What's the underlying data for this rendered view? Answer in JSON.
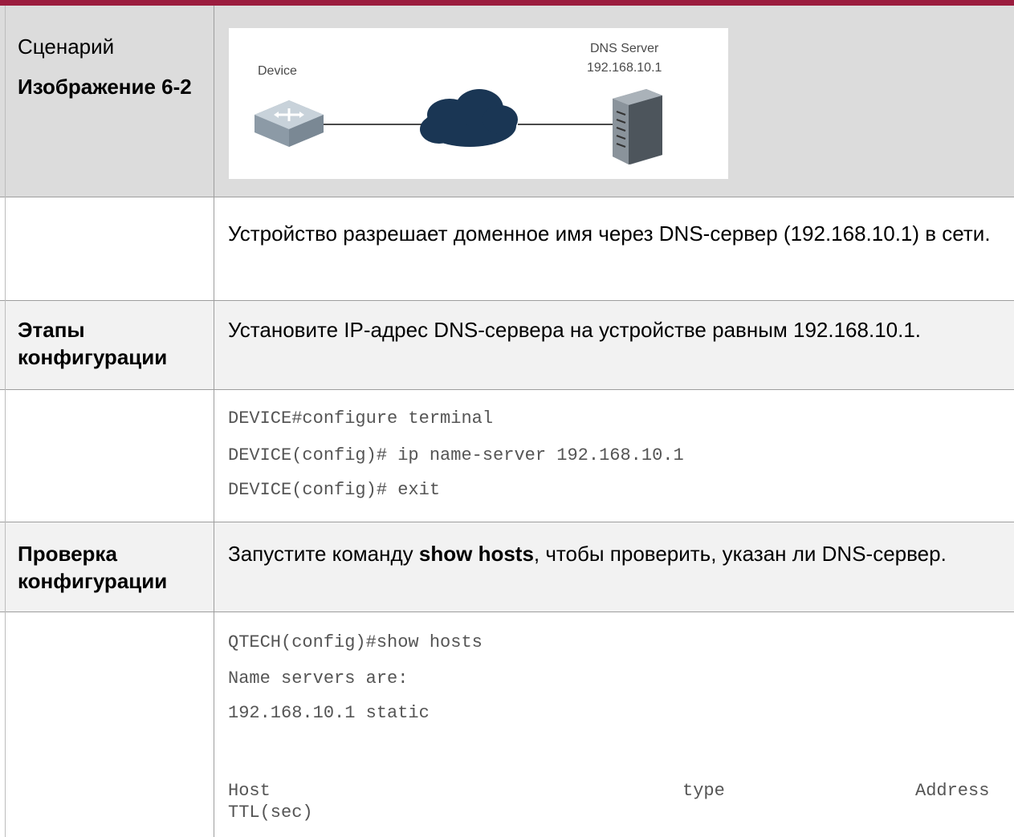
{
  "scenario": {
    "label": "Сценарий",
    "figure_label": "Изображение 6-2",
    "diagram": {
      "device_label": "Device",
      "server_label": "DNS Server",
      "server_ip": "192.168.10.1"
    }
  },
  "description": "Устройство разрешает доменное имя через DNS-сервер (192.168.10.1) в сети.",
  "config_steps": {
    "label_line1": "Этапы",
    "label_line2": "конфигурации",
    "text": "Установите IP-адрес DNS-сервера на устройстве равным 192.168.10.1."
  },
  "config_code": [
    "DEVICE#configure terminal",
    "DEVICE(config)# ip name-server 192.168.10.1",
    "DEVICE(config)# exit"
  ],
  "verification": {
    "label_line1": "Проверка",
    "label_line2": "конфигурации",
    "text_before": "Запустите команду ",
    "command": "show hosts",
    "text_after": ", чтобы проверить, указан ли DNS-сервер."
  },
  "verify_output": {
    "lines": [
      "QTECH(config)#show hosts",
      "Name servers are:",
      "192.168.10.1 static"
    ],
    "table_header": {
      "host": "Host",
      "type": "type",
      "address": "Address",
      "ttl": "TTL(sec)"
    }
  }
}
